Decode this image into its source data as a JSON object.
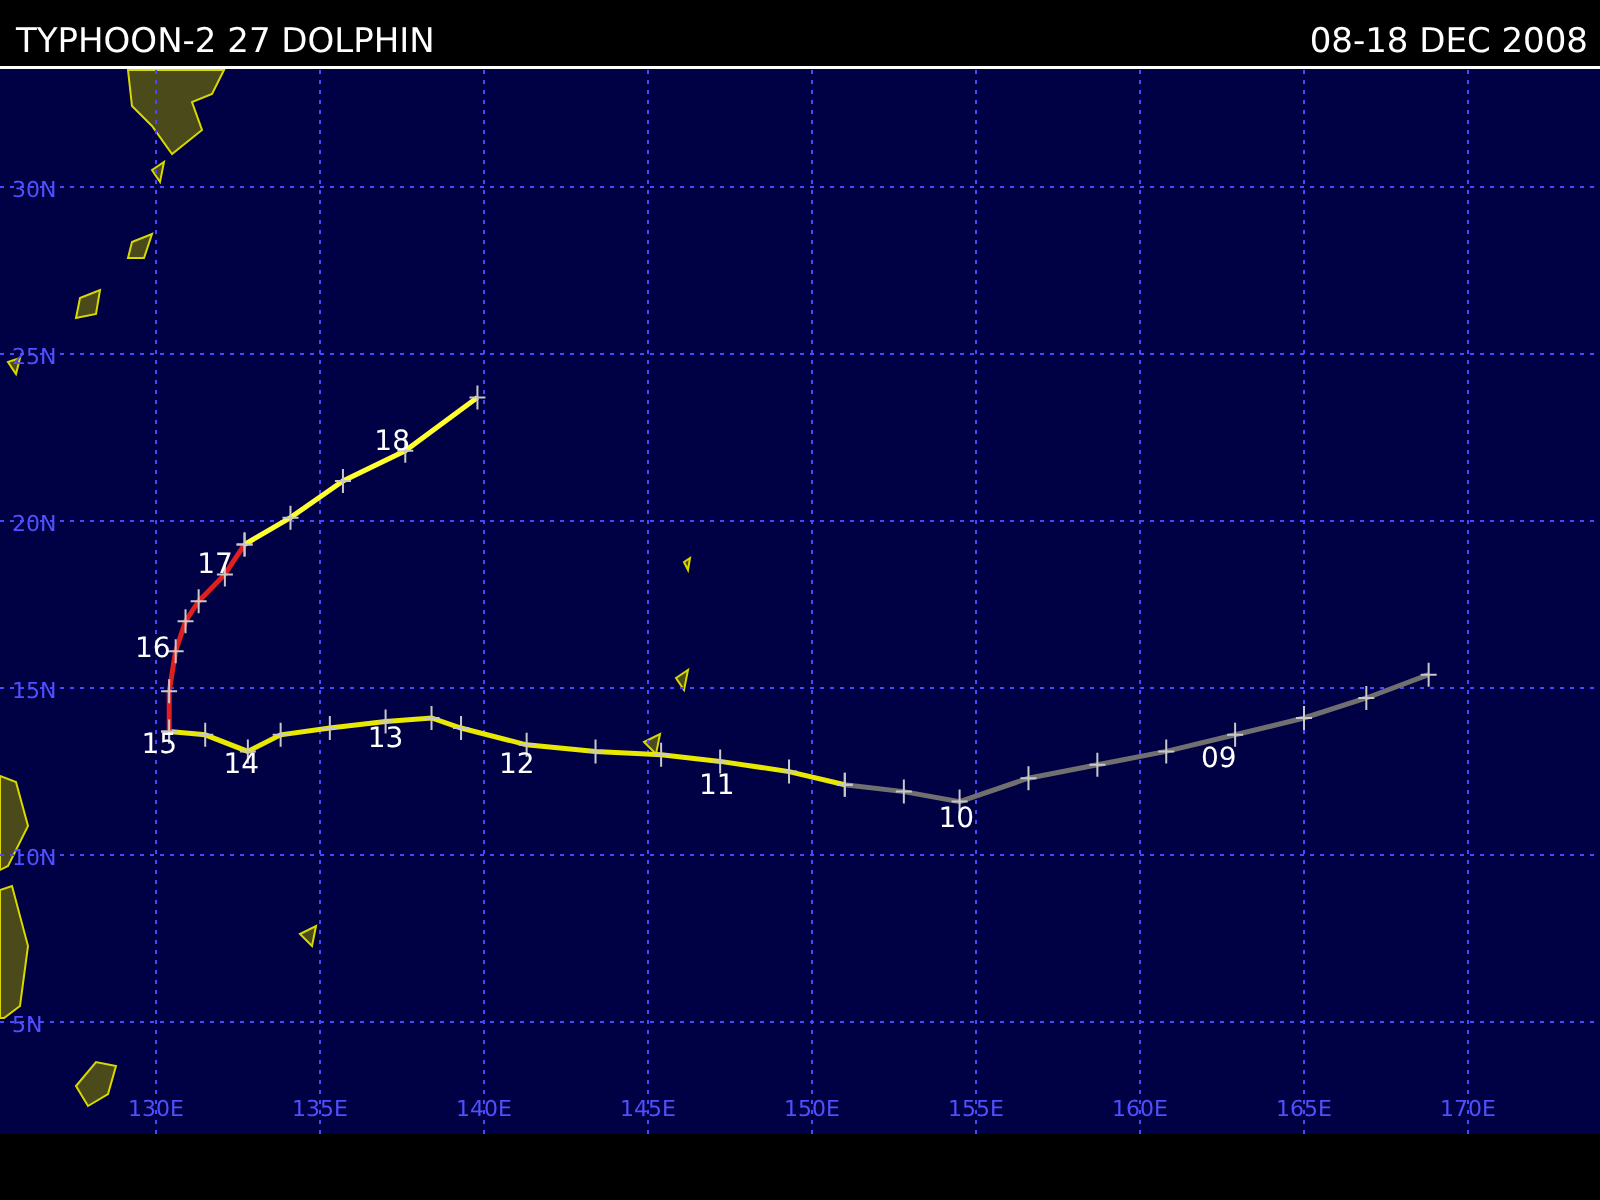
{
  "header": {
    "title": "TYPHOON-2 27 DOLPHIN",
    "dates": "08-18 DEC 2008"
  },
  "map": {
    "lat_labels": [
      "30N",
      "25N",
      "20N",
      "15N",
      "10N",
      "5N"
    ],
    "lon_labels": [
      "130E",
      "135E",
      "140E",
      "145E",
      "150E",
      "155E",
      "160E",
      "165E",
      "170E"
    ]
  },
  "track": {
    "segments": [
      {
        "color": "#707070"
      },
      {
        "color": "#e8e800"
      },
      {
        "color": "#e02020"
      },
      {
        "color": "#ffff30"
      }
    ],
    "days": [
      "09",
      "10",
      "11",
      "12",
      "13",
      "14",
      "15",
      "16",
      "17",
      "18"
    ]
  }
}
